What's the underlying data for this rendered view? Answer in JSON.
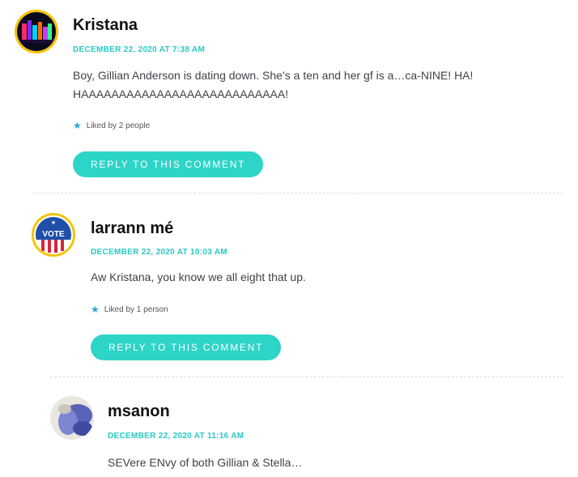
{
  "comments": [
    {
      "author": "Kristana",
      "date": "DECEMBER 22, 2020 AT 7:38 AM",
      "body": [
        "Boy, Gillian Anderson is dating down. She’s a ten and her gf is a…ca-NINE! HA!",
        "HAAAAAAAAAAAAAAAAAAAAAAAAAAA!"
      ],
      "likes": "Liked by 2 people",
      "reply_label": "REPLY TO THIS COMMENT"
    },
    {
      "author": "larrann mé",
      "date": "DECEMBER 22, 2020 AT 10:03 AM",
      "body": [
        "Aw Kristana, you know we all eight that up."
      ],
      "likes": "Liked by 1 person",
      "reply_label": "REPLY TO THIS COMMENT",
      "avatar_text": "VOTE"
    },
    {
      "author": "msanon",
      "date": "DECEMBER 22, 2020 AT 11:16 AM",
      "body": [
        "SEVere ENvy of both Gillian & Stella…"
      ]
    }
  ],
  "icons": {
    "like": "star-icon"
  },
  "colors": {
    "accent": "#2dd4c8",
    "date": "#2ac9c4",
    "avatar_ring": "#f5c400"
  }
}
